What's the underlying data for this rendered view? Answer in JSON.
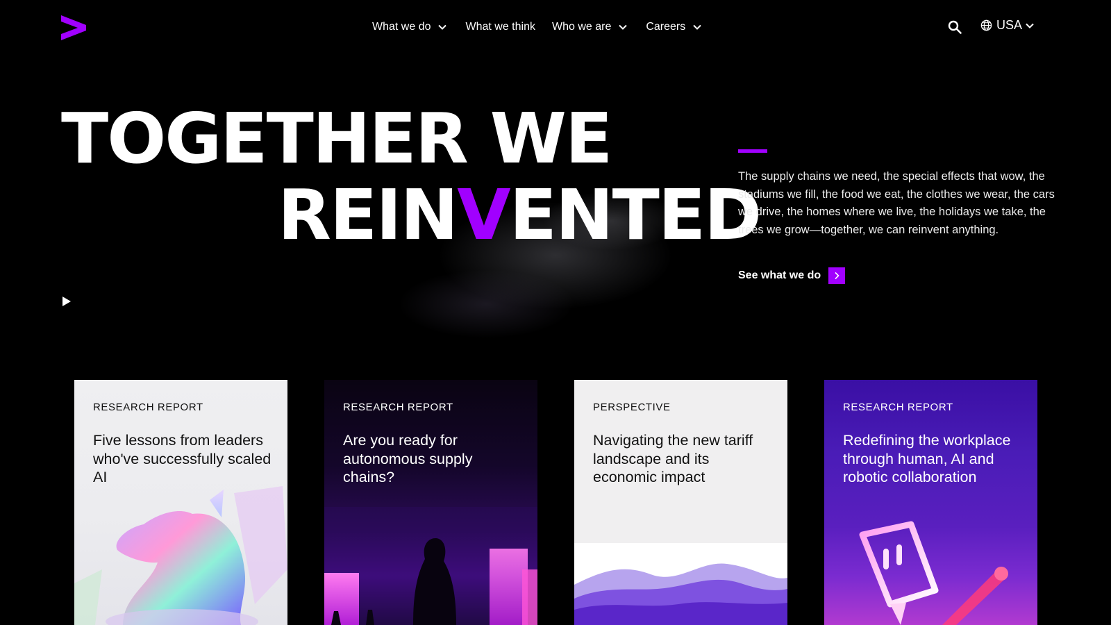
{
  "header": {
    "logo_name": "brand-greater-than-logo",
    "nav": [
      {
        "label": "What we do",
        "has_dropdown": true
      },
      {
        "label": "What we think",
        "has_dropdown": false
      },
      {
        "label": "Who we are",
        "has_dropdown": true
      },
      {
        "label": "Careers",
        "has_dropdown": true
      }
    ],
    "search_icon": "search-icon",
    "locale": {
      "icon": "globe-icon",
      "label": "USA"
    }
  },
  "hero": {
    "headline_line1": "TOGETHER WE",
    "headline_line2_before": "REIN",
    "headline_line2_accent": "V",
    "headline_line2_after": "ENTED",
    "description": "The supply chains we need, the special effects that wow, the cars we drive, the homes where we live, the holidays we take, the trees we grow—together, we can reinvent anything.",
    "description_full": "The supply chains we need, the special effects that wow, the stadiums we fill, the food we eat, the clothes we wear, the cars we drive, the homes where we live, the holidays we take, the trees we grow—together, we can reinvent anything.",
    "cta_label": "See what we do",
    "play_icon": "play-icon"
  },
  "cards": [
    {
      "tag": "RESEARCH REPORT",
      "title": "Five lessons from leaders who've successfully scaled AI"
    },
    {
      "tag": "RESEARCH REPORT",
      "title": "Are you ready for autonomous supply chains?"
    },
    {
      "tag": "PERSPECTIVE",
      "title": "Navigating the new tariff landscape and its economic impact"
    },
    {
      "tag": "RESEARCH REPORT",
      "title": "Redefining the workplace through human, AI and robotic collaboration"
    }
  ],
  "colors": {
    "accent": "#a100ff",
    "background": "#000000"
  }
}
